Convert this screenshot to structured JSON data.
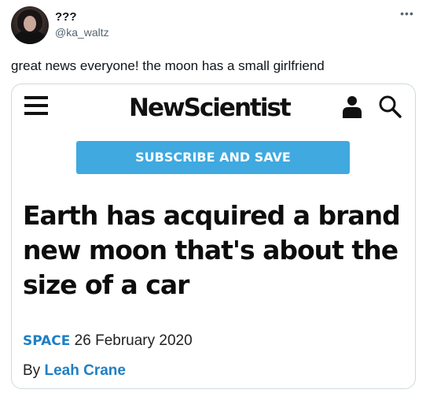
{
  "tweet": {
    "display_name": "???",
    "handle": "@ka_waltz",
    "text": "great news everyone! the moon has a small girlfriend",
    "more_label": "•••"
  },
  "card": {
    "brand_name": "NewScientist",
    "subscribe_label": "SUBSCRIBE AND SAVE",
    "headline": "Earth has acquired a brand new moon that's about the size of a car",
    "category": "SPACE",
    "date": "26 February 2020",
    "byline_prefix": "By",
    "author": "Leah Crane",
    "icons": {
      "menu": "menu-icon",
      "user": "user-icon",
      "search": "search-icon"
    }
  },
  "colors": {
    "subscribe_bg": "#3fa9e0",
    "link": "#1f7fc4",
    "card_border": "#cfd9de",
    "muted_text": "#536471"
  }
}
